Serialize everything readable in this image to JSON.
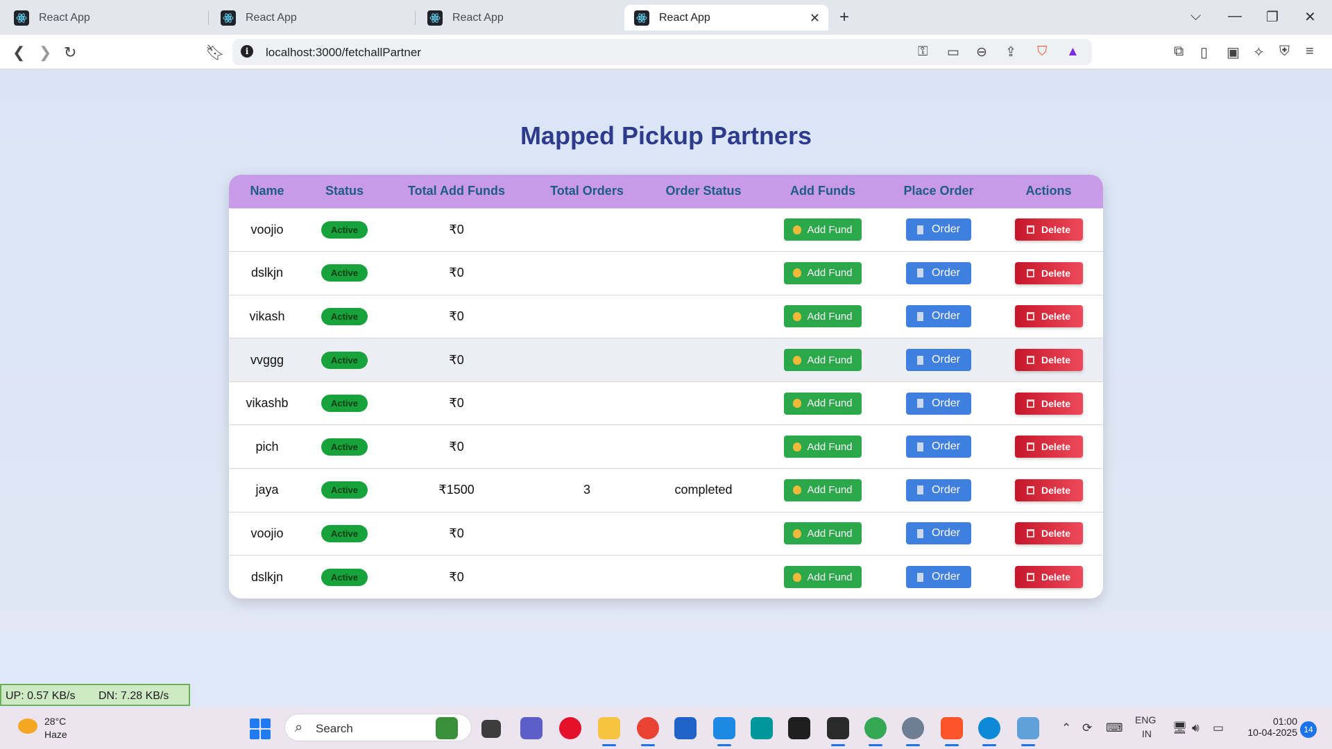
{
  "browser": {
    "tabs": [
      {
        "title": "React App"
      },
      {
        "title": "React App"
      },
      {
        "title": "React App"
      },
      {
        "title": "React App",
        "active": true
      }
    ],
    "url": "localhost:3000/fetchallPartner"
  },
  "page": {
    "title": "Mapped Pickup Partners",
    "columns": [
      "Name",
      "Status",
      "Total Add Funds",
      "Total Orders",
      "Order Status",
      "Add Funds",
      "Place Order",
      "Actions"
    ],
    "buttons": {
      "add_fund": "Add Fund",
      "order": "Order",
      "delete": "Delete"
    },
    "rows": [
      {
        "name": "voojio",
        "status": "Active",
        "funds": "₹0",
        "orders": "",
        "order_status": ""
      },
      {
        "name": "dslkjn",
        "status": "Active",
        "funds": "₹0",
        "orders": "",
        "order_status": ""
      },
      {
        "name": "vikash",
        "status": "Active",
        "funds": "₹0",
        "orders": "",
        "order_status": ""
      },
      {
        "name": "vvggg",
        "status": "Active",
        "funds": "₹0",
        "orders": "",
        "order_status": ""
      },
      {
        "name": "vikashb",
        "status": "Active",
        "funds": "₹0",
        "orders": "",
        "order_status": ""
      },
      {
        "name": "pich",
        "status": "Active",
        "funds": "₹0",
        "orders": "",
        "order_status": ""
      },
      {
        "name": "jaya",
        "status": "Active",
        "funds": "₹1500",
        "orders": "3",
        "order_status": "completed"
      },
      {
        "name": "voojio",
        "status": "Active",
        "funds": "₹0",
        "orders": "",
        "order_status": ""
      },
      {
        "name": "dslkjn",
        "status": "Active",
        "funds": "₹0",
        "orders": "",
        "order_status": ""
      }
    ]
  },
  "netspeed": {
    "up": "UP: 0.57 KB/s",
    "down": "DN: 7.28 KB/s"
  },
  "taskbar": {
    "weather_temp": "28°C",
    "weather_desc": "Haze",
    "search_label": "Search",
    "lang_top": "ENG",
    "lang_bottom": "IN",
    "time": "01:00",
    "date": "10-04-2025",
    "notifications": "14"
  },
  "colors": {
    "header_bg": "#c89ae8",
    "title": "#2e3a8c",
    "active_badge": "#18a23b",
    "add_fund": "#2aa84a",
    "order": "#3f7fe0",
    "delete": "#d4202f"
  }
}
